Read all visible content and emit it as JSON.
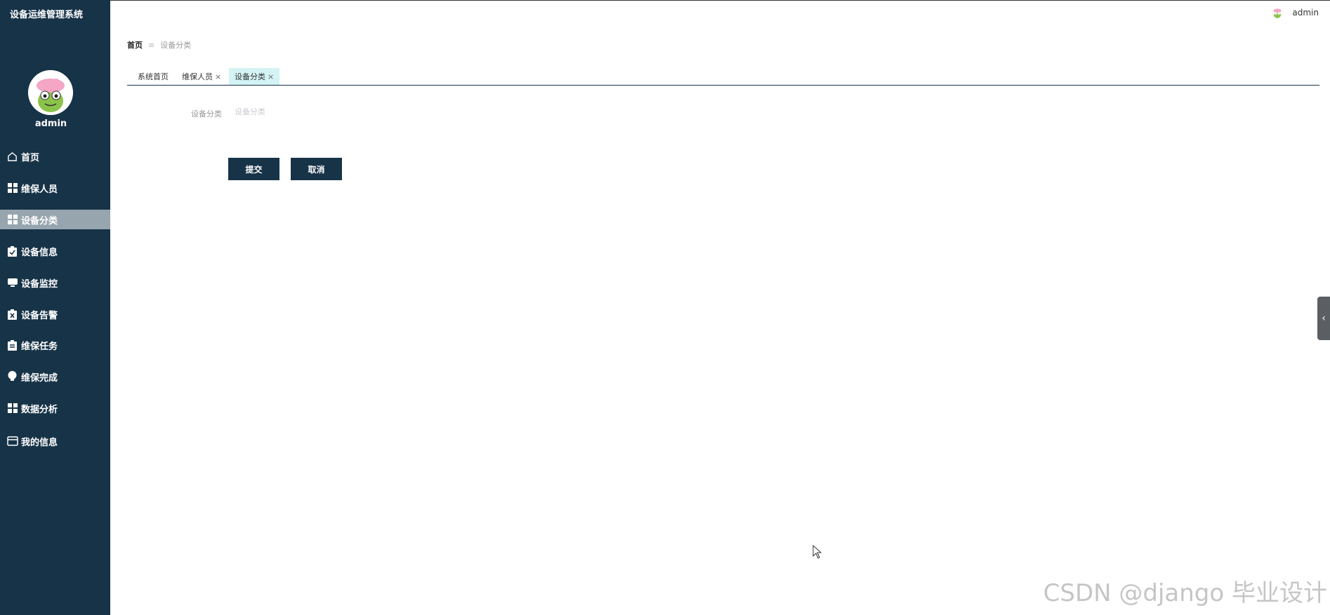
{
  "app": {
    "title": "设备运维管理系统"
  },
  "sidebar": {
    "username": "admin",
    "items": [
      {
        "label": "首页",
        "icon": "home-icon"
      },
      {
        "label": "维保人员",
        "icon": "grid-icon"
      },
      {
        "label": "设备分类",
        "icon": "grid-icon",
        "active": true
      },
      {
        "label": "设备信息",
        "icon": "clipboard-check-icon"
      },
      {
        "label": "设备监控",
        "icon": "monitor-icon"
      },
      {
        "label": "设备告警",
        "icon": "clipboard-x-icon"
      },
      {
        "label": "维保任务",
        "icon": "clipboard-list-icon"
      },
      {
        "label": "维保完成",
        "icon": "bulb-icon"
      },
      {
        "label": "数据分析",
        "icon": "grid-icon"
      },
      {
        "label": "我的信息",
        "icon": "card-icon"
      }
    ]
  },
  "header": {
    "username": "admin"
  },
  "breadcrumb": {
    "home": "首页",
    "current": "设备分类"
  },
  "tabs": [
    {
      "label": "系统首页",
      "closable": false
    },
    {
      "label": "维保人员",
      "closable": true
    },
    {
      "label": "设备分类",
      "closable": true,
      "active": true
    }
  ],
  "tab_close_symbol": "×",
  "form": {
    "category_label": "设备分类",
    "category_value": "",
    "category_placeholder": "设备分类",
    "submit_label": "提交",
    "cancel_label": "取消"
  },
  "watermark": "CSDN @django 毕业设计",
  "colors": {
    "sidebar_bg": "#173347",
    "active_item_bg": "#97a5ae",
    "active_tab_bg": "#d3f3f5",
    "button_bg": "#173347"
  }
}
